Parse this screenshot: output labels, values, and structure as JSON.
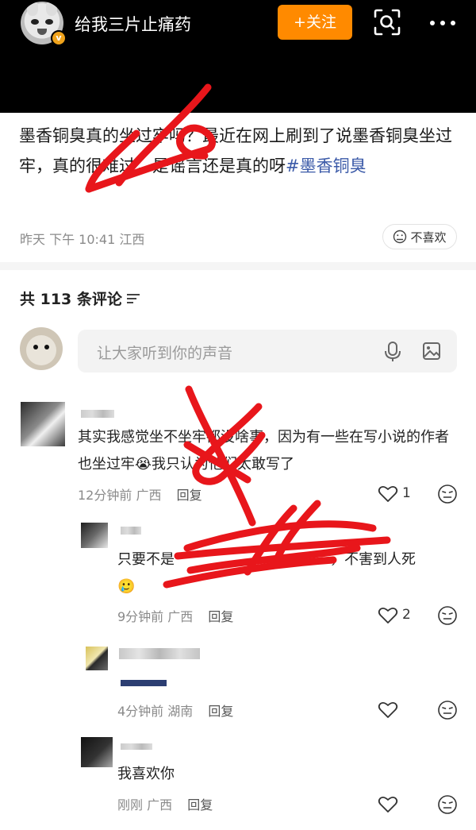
{
  "header": {
    "username": "给我三片止痛药",
    "verified_badge": "v",
    "follow_label": "+关注",
    "icons": [
      "scan-icon",
      "more-icon"
    ]
  },
  "post": {
    "text": "墨香铜臭真的坐过牢吗？最近在网上刷到了说墨香铜臭坐过牢，真的很难过，是谣言还是真的呀",
    "hashtag": "#墨香铜臭",
    "meta": "昨天 下午 10:41 江西",
    "dislike_label": "不喜欢"
  },
  "comments_header": {
    "count_label": "共 113 条评论"
  },
  "composer": {
    "placeholder": "让大家听到你的声音"
  },
  "comments": [
    {
      "text": "其实我感觉坐不坐牢都没啥事，因为有一些在写小说的作者也坐过牢😭我只认为他们太敢写了",
      "time": "12分钟前",
      "location": "广西",
      "reply_label": "回复",
      "likes": "1"
    },
    {
      "text": "只要不是",
      "text_end": "，不害到人死",
      "emoji": "🥲",
      "time": "9分钟前",
      "location": "广西",
      "reply_label": "回复",
      "likes": "2"
    },
    {
      "time": "4分钟前",
      "location": "湖南",
      "reply_label": "回复"
    },
    {
      "text": "我喜欢你",
      "time": "刚刚",
      "location": "广西",
      "reply_label": "回复"
    }
  ],
  "colors": {
    "header_bg": "#000000",
    "follow_button": "#ff8a00",
    "hashtag": "#3b5aa8",
    "scribble": "#e8161b"
  }
}
